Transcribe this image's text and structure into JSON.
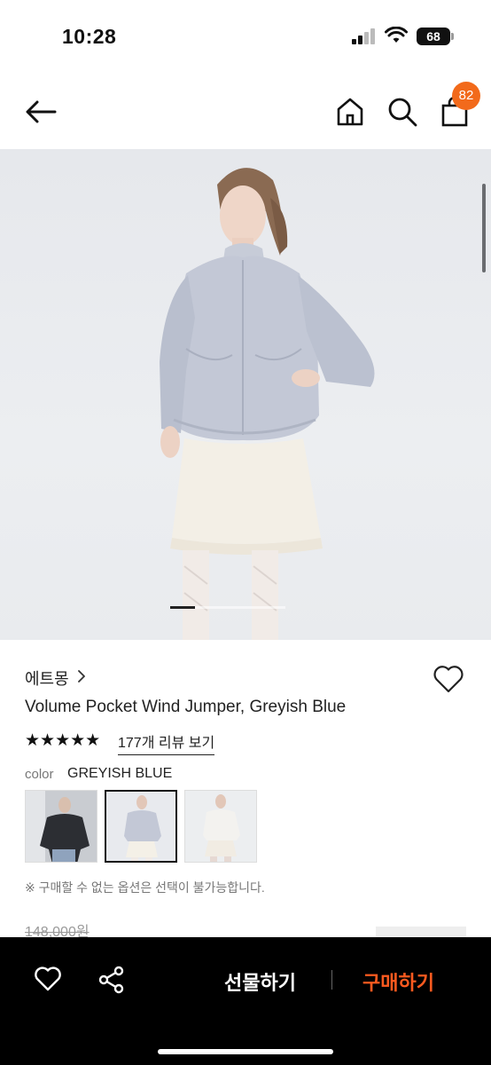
{
  "status_bar": {
    "time": "10:28",
    "battery": "68",
    "icons": [
      "signal-icon",
      "wifi-icon",
      "battery-icon"
    ]
  },
  "nav": {
    "icons": [
      "back-arrow-icon",
      "home-icon",
      "search-icon",
      "shopping-bag-icon"
    ],
    "cart_count": "82",
    "badge_color": "#f26a1b"
  },
  "gallery": {
    "active_index": 1
  },
  "product": {
    "brand": "에트몽",
    "title": "Volume Pocket Wind Jumper, Greyish Blue",
    "rating": 5,
    "stars": "★★★★★",
    "review_link": "177개 리뷰 보기",
    "color_label": "color",
    "color_value": "GREYISH BLUE",
    "swatches": [
      "black-jumper",
      "greyish-blue-jumper",
      "white-jumper"
    ],
    "selected_swatch": 2,
    "option_note": "※ 구매할 수 없는 옵션은 선택이 불가능합니다.",
    "original_price": "148,000원"
  },
  "bottom_bar": {
    "gift_label": "선물하기",
    "buy_label": "구매하기",
    "buy_color": "#ff5a1f",
    "icons": [
      "heart-icon",
      "share-icon"
    ]
  }
}
